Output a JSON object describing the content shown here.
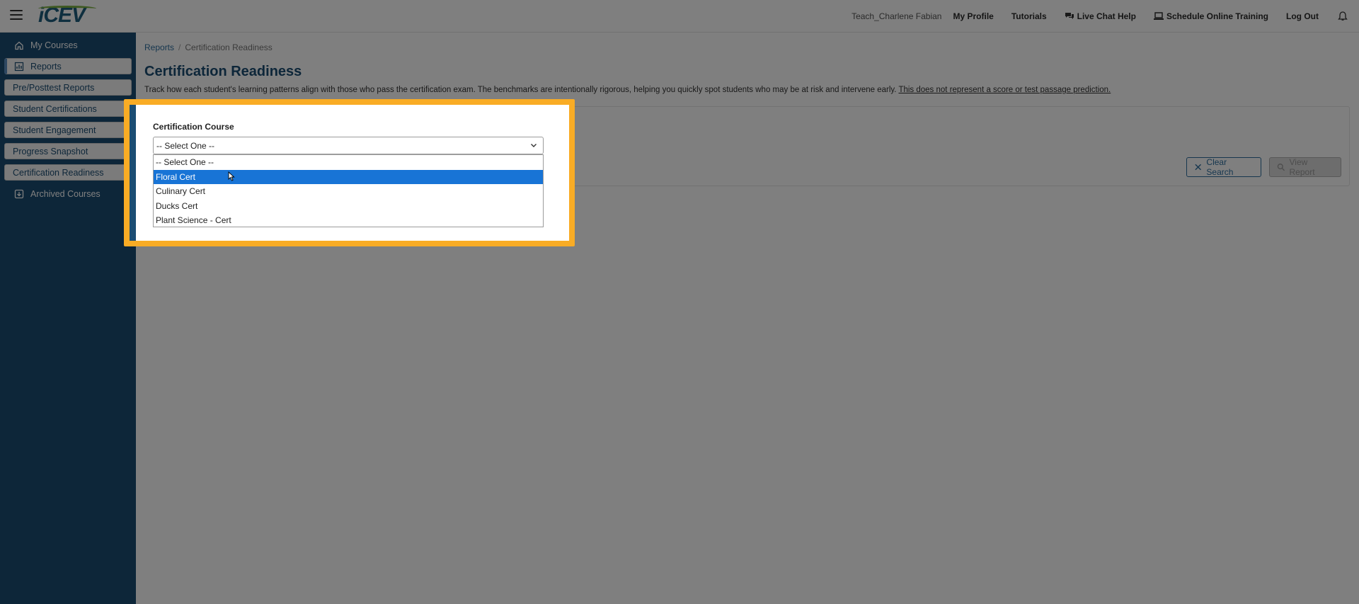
{
  "header": {
    "logo_text": "iCEV",
    "user_name": "Teach_Charlene Fabian",
    "links": {
      "my_profile": "My Profile",
      "tutorials": "Tutorials",
      "live_chat": "Live Chat Help",
      "schedule_training": "Schedule Online Training",
      "log_out": "Log Out"
    }
  },
  "sidebar": {
    "my_courses": "My Courses",
    "reports": "Reports",
    "sub_items": [
      "Pre/Posttest Reports",
      "Student Certifications",
      "Student Engagement",
      "Progress Snapshot",
      "Certification Readiness"
    ],
    "archived_courses": "Archived Courses"
  },
  "breadcrumb": {
    "parent": "Reports",
    "separator": "/",
    "current": "Certification Readiness"
  },
  "page": {
    "title": "Certification Readiness",
    "description": "Track how each student's learning patterns align with those who pass the certification exam. The benchmarks are intentionally rigorous, helping you quickly spot students who may be at risk and intervene early. ",
    "description_link": "This does not represent a score or test passage prediction."
  },
  "filters": {
    "course_label": "Certification Course",
    "selected_value": "-- Select One --",
    "options": [
      "-- Select One --",
      "Floral Cert",
      "Culinary Cert",
      "Ducks Cert",
      "Plant Science - Cert"
    ],
    "highlighted_option": "Floral Cert",
    "clear_search_label": "Clear Search",
    "view_report_label": "View Report"
  },
  "colors": {
    "sidebar_bg": "#1b4d73",
    "highlight_border": "#f9ac25",
    "selected_option_bg": "#1874d6",
    "title_color": "#1b4d73"
  }
}
